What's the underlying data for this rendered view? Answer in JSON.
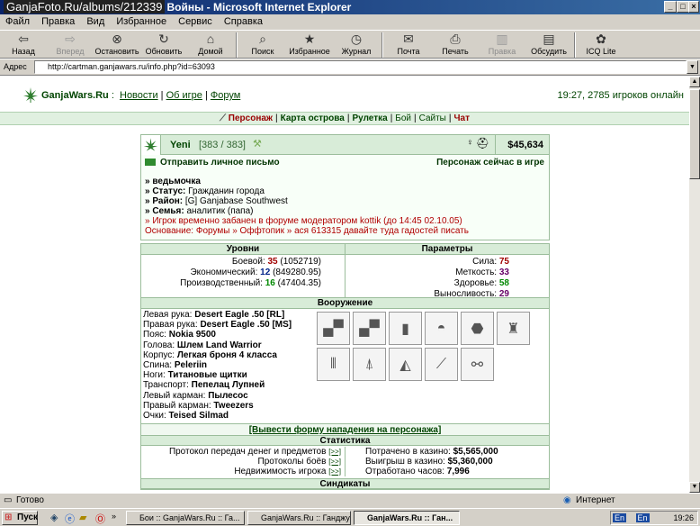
{
  "window": {
    "watermark": "GanjaFoto.Ru/albums/212339",
    "title": "Войны - Microsoft Internet Explorer"
  },
  "menu": [
    "Файл",
    "Правка",
    "Вид",
    "Избранное",
    "Сервис",
    "Справка"
  ],
  "toolbar": [
    {
      "label": "Назад",
      "icon": "back-icon",
      "glyph": "⇦",
      "enabled": true
    },
    {
      "label": "Вперед",
      "icon": "forward-icon",
      "glyph": "⇨",
      "enabled": false
    },
    {
      "label": "Остановить",
      "icon": "stop-icon",
      "glyph": "⊗",
      "enabled": true
    },
    {
      "label": "Обновить",
      "icon": "refresh-icon",
      "glyph": "↻",
      "enabled": true
    },
    {
      "label": "Домой",
      "icon": "home-icon",
      "glyph": "⌂",
      "enabled": true
    },
    {
      "label": "Поиск",
      "icon": "search-icon",
      "glyph": "⌕",
      "enabled": true
    },
    {
      "label": "Избранное",
      "icon": "favorites-icon",
      "glyph": "★",
      "enabled": true
    },
    {
      "label": "Журнал",
      "icon": "history-icon",
      "glyph": "◷",
      "enabled": true
    },
    {
      "label": "Почта",
      "icon": "mail-icon",
      "glyph": "✉",
      "enabled": true
    },
    {
      "label": "Печать",
      "icon": "print-icon",
      "glyph": "⎙",
      "enabled": true
    },
    {
      "label": "Правка",
      "icon": "edit-icon",
      "glyph": "▥",
      "enabled": false
    },
    {
      "label": "Обсудить",
      "icon": "discuss-icon",
      "glyph": "▤",
      "enabled": true
    },
    {
      "label": "ICQ Lite",
      "icon": "icq-icon",
      "glyph": "✿",
      "enabled": true
    }
  ],
  "address": {
    "label": "Адрес",
    "url": "http://cartman.ganjawars.ru/info.php?id=63093"
  },
  "site": {
    "name": "GanjaWars.Ru",
    "sep": ":",
    "links": [
      "Новости",
      "Об игре",
      "Форум"
    ],
    "online": "19:27, 2785 игроков онлайн"
  },
  "gamenav": [
    "Персонаж",
    "Карта острова",
    "Рулетка",
    "Бой",
    "Сайты",
    "Чат"
  ],
  "profile": {
    "name": "Yeni",
    "level": "[383 / 383]",
    "money": "$45,634",
    "mail": "Отправить личное письмо",
    "ingame": "Персонаж сейчас в игре",
    "title": "» ведьмочка",
    "status_label": "» Статус:",
    "status": "Гражданин города",
    "district_label": "» Район:",
    "district": "[G] Ganjabase Southwest",
    "family_label": "» Семья:",
    "family": "аналитик (папа)",
    "ban": "» Игрок временно забанен в форуме модератором kottik (до 14:45 02.10.05)",
    "reason": "Основание: Форумы » Оффтопик » ася 613315 давайте туда гадостей писать"
  },
  "levels": {
    "title": "Уровни",
    "items": [
      {
        "label": "Боевой:",
        "value": "35",
        "extra": "(1052719)"
      },
      {
        "label": "Экономический:",
        "value": "12",
        "extra": "(849280.95)"
      },
      {
        "label": "Производственный:",
        "value": "16",
        "extra": "(47404.35)"
      }
    ]
  },
  "params": {
    "title": "Параметры",
    "items": [
      {
        "label": "Сила:",
        "value": "75"
      },
      {
        "label": "Меткость:",
        "value": "33"
      },
      {
        "label": "Здоровье:",
        "value": "58"
      },
      {
        "label": "Выносливость:",
        "value": "29"
      }
    ]
  },
  "weapons": {
    "title": "Вооружение",
    "items": [
      {
        "label": "Левая рука:",
        "value": "Desert Eagle .50 [RL]"
      },
      {
        "label": "Правая рука:",
        "value": "Desert Eagle .50 [MS]"
      },
      {
        "label": "Пояс:",
        "value": "Nokia 9500"
      },
      {
        "label": "Голова:",
        "value": "Шлем Land Warrior"
      },
      {
        "label": "Корпус:",
        "value": "Легкая броня 4 класса"
      },
      {
        "label": "Спина:",
        "value": "Peleriin"
      },
      {
        "label": "Ноги:",
        "value": "Титановые щитки"
      },
      {
        "label": "Транспорт:",
        "value": "Пепелац Лупней"
      },
      {
        "label": "Левый карман:",
        "value": "Пылесос"
      },
      {
        "label": "Правый карман:",
        "value": "Tweezers"
      },
      {
        "label": "Очки:",
        "value": "Teised Silmad"
      }
    ],
    "slots": [
      "pistol",
      "pistol",
      "phone",
      "helmet",
      "armor",
      "vest",
      "shin-guards",
      "bell",
      "vacuum",
      "tweezers",
      "glasses"
    ]
  },
  "attack": "[Вывести форму нападения на персонажа]",
  "statistics": {
    "title": "Статистика",
    "left": [
      {
        "label": "Протокол передач денег и предметов",
        "link": "[>>]"
      },
      {
        "label": "Протоколы боёв",
        "link": "[>>]"
      },
      {
        "label": "Недвижимость игрока",
        "link": "[>>]"
      }
    ],
    "right": [
      {
        "label": "Потрачено в казино:",
        "value": "$5,565,000"
      },
      {
        "label": "Выигрыш в казино:",
        "value": "$5,360,000"
      },
      {
        "label": "Отработано часов:",
        "value": "7,996"
      }
    ]
  },
  "syndicates": {
    "title": "Синдикаты"
  },
  "statusbar": {
    "left": "Готово",
    "right": "Интернет"
  },
  "taskbar": {
    "start": "Пуск",
    "tasks": [
      "Бои :: GanjaWars.Ru :: Га...",
      "GanjaWars.Ru :: Ганджуб...",
      "GanjaWars.Ru :: Ган..."
    ],
    "lang1": "En",
    "lang2": "En",
    "clock": "19:26"
  }
}
